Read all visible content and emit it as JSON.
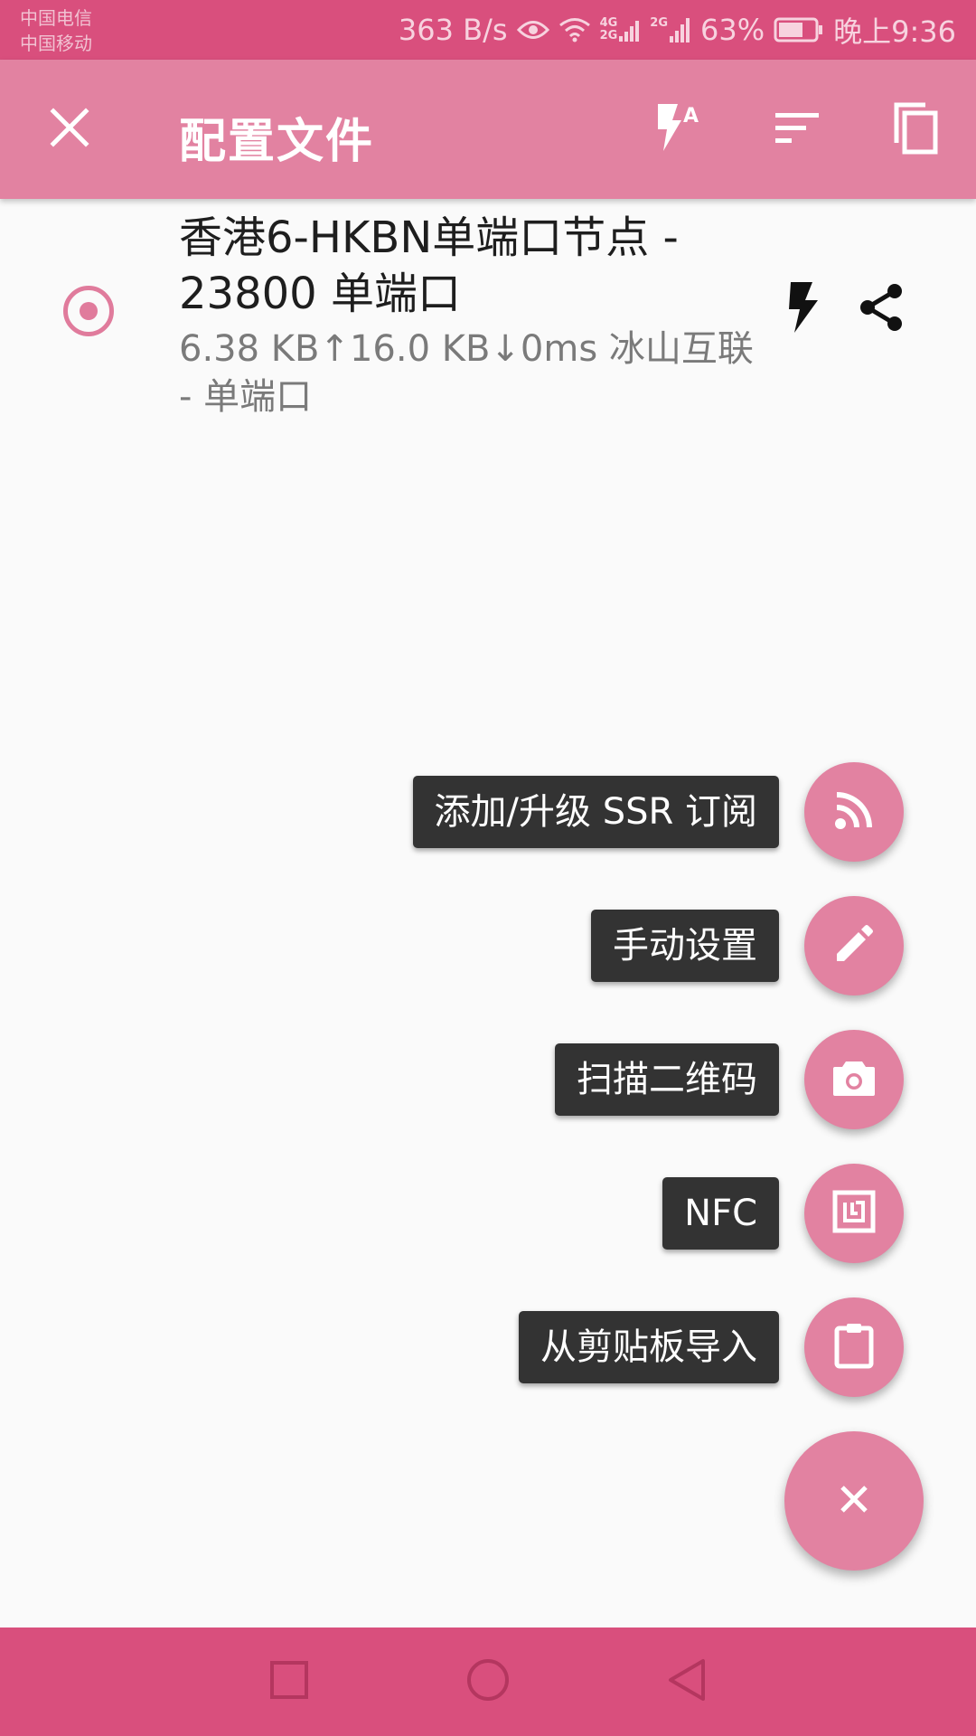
{
  "status_bar": {
    "carrier_1": "中国电信",
    "carrier_2": "中国移动",
    "net_speed": "363 B/s",
    "sig1_label_top": "4G",
    "sig1_label_bottom": "2G",
    "sig2_label": "2G",
    "battery": "63%",
    "time": "晚上9:36"
  },
  "toolbar": {
    "title": "配置文件",
    "icons": [
      "close-icon",
      "flash-auto-icon",
      "sort-icon",
      "copy-icon"
    ]
  },
  "profile": {
    "name": "香港6-HKBN单端口节点 - 23800 单端口",
    "subtitle": "6.38 KB↑16.0 KB↓0ms 冰山互联 - 单端口",
    "selected": true
  },
  "fab_menu": {
    "items": [
      {
        "label": "添加/升级 SSR 订阅",
        "icon": "rss-icon"
      },
      {
        "label": "手动设置",
        "icon": "pencil-icon"
      },
      {
        "label": "扫描二维码",
        "icon": "camera-icon"
      },
      {
        "label": "NFC",
        "icon": "nfc-icon"
      },
      {
        "label": "从剪贴板导入",
        "icon": "clipboard-icon"
      }
    ],
    "close_icon": "close-icon"
  },
  "colors": {
    "status_bar": "#d94f7d",
    "toolbar": "#e282a1",
    "accent": "#e07b9c",
    "label_bg": "#333333"
  }
}
